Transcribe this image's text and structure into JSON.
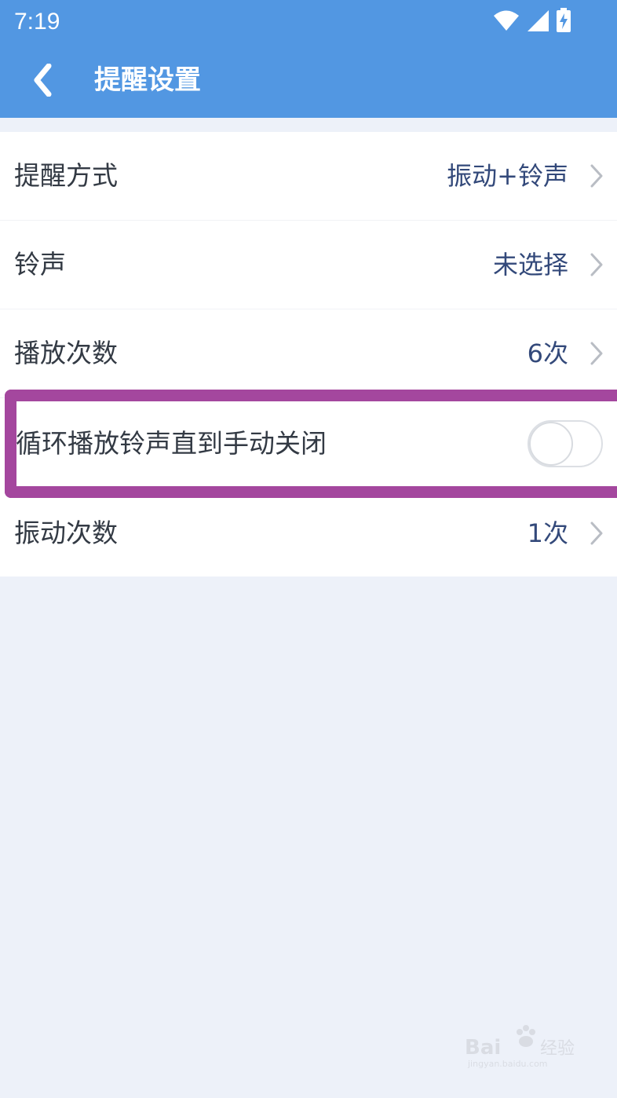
{
  "status_bar": {
    "time": "7:19",
    "icons": [
      "wifi-icon",
      "cellular-signal-icon",
      "battery-charging-icon"
    ]
  },
  "header": {
    "title": "提醒设置",
    "back_icon": "chevron-left-icon"
  },
  "settings": [
    {
      "label": "提醒方式",
      "value": "振动+铃声",
      "control": "chevron"
    },
    {
      "label": "铃声",
      "value": "未选择",
      "control": "chevron"
    },
    {
      "label": "播放次数",
      "value": "6次",
      "control": "chevron"
    },
    {
      "label": "循环播放铃声直到手动关闭",
      "value": "",
      "control": "toggle",
      "toggle_on": false
    },
    {
      "label": "振动次数",
      "value": "1次",
      "control": "chevron"
    }
  ],
  "colors": {
    "header_bg": "#5297e2",
    "page_bg": "#edf1f9",
    "value_text": "#33497a",
    "highlight_border": "#a4479e"
  }
}
